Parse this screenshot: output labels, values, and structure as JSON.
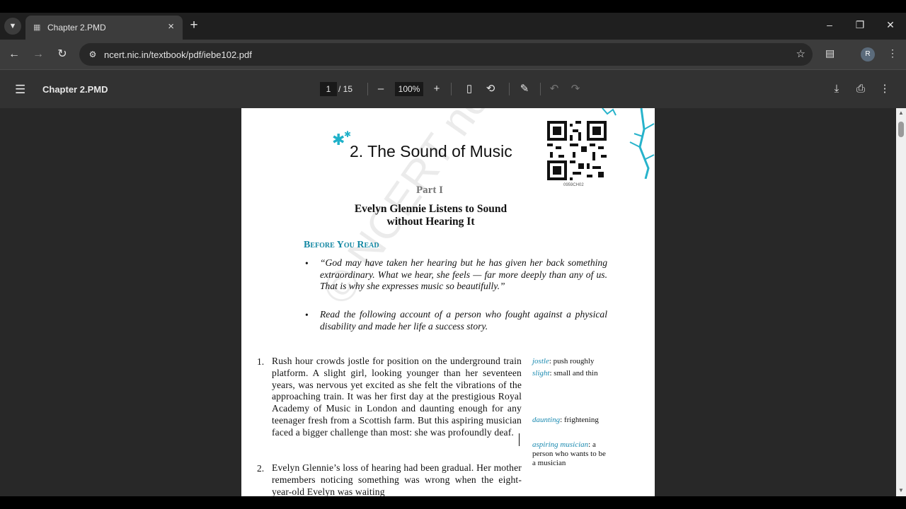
{
  "tab": {
    "title": "Chapter 2.PMD"
  },
  "address_bar": {
    "url": "ncert.nic.in/textbook/pdf/iebe102.pdf"
  },
  "profile": {
    "initial": "R"
  },
  "pdf_toolbar": {
    "title": "Chapter 2.PMD",
    "current_page": "1",
    "total_pages": "/ 15",
    "zoom": "100%"
  },
  "page": {
    "chapter_title": "2. The Sound of Music",
    "qr_code_label": "0959CH02",
    "part": "Part I",
    "subtitle_line1": "Evelyn Glennie Listens to Sound",
    "subtitle_line2": "without Hearing It",
    "before_you_read": "Before You Read",
    "bullets": [
      "“God may have taken her hearing but he has given her back something extraordinary. What we hear, she feels — far more deeply than any of us. That is why she expresses music so beautifully.”",
      "Read the following account of a person who fought against a physical disability and made her life a success story."
    ],
    "watermark": "© NCERT not to be republished",
    "paragraphs": [
      {
        "num": "1.",
        "text": "Rush hour crowds jostle for position on the underground train platform. A slight girl, looking younger than her seventeen years, was nervous yet excited as she felt the vibrations of the approaching train. It was her first day at the prestigious Royal Academy of Music in London and daunting enough for any teenager fresh from a Scottish farm. But this aspiring musician faced a bigger challenge than most: she was profoundly deaf."
      },
      {
        "num": "2.",
        "text": "Evelyn Glennie’s loss of hearing had been gradual. Her mother remembers noticing something was wrong when the eight-year-old Evelyn was waiting"
      }
    ],
    "glossary": [
      {
        "term": "jostle",
        "def": " push roughly"
      },
      {
        "term": "slight",
        "def": " small and thin"
      },
      {
        "term": "daunting",
        "def": " frightening"
      },
      {
        "term": "aspiring musician",
        "def": " a person who wants to be a musician"
      }
    ]
  },
  "colors": {
    "accent": "#1689a4",
    "page_bg": "#ffffff",
    "viewer_bg": "#282828"
  }
}
